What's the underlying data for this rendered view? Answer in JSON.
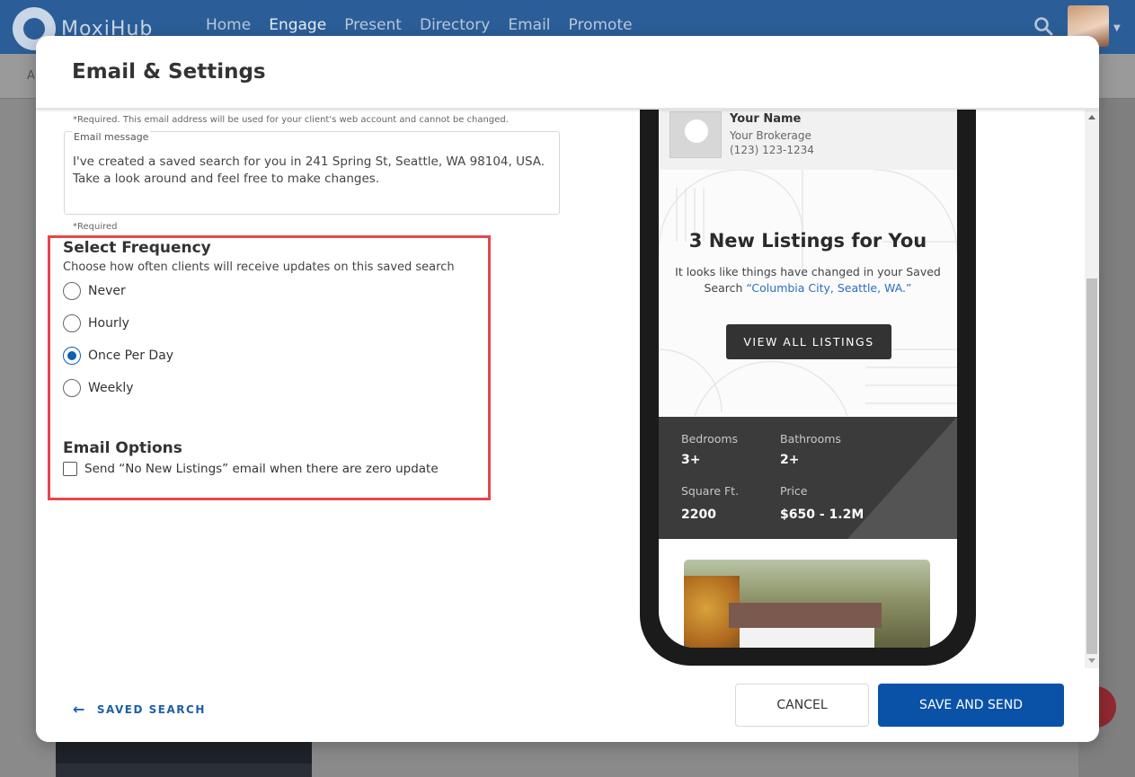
{
  "nav": {
    "logo": "MoxiHub",
    "links": [
      "Home",
      "Engage",
      "Present",
      "Directory",
      "Email",
      "Promote"
    ],
    "active": "Engage",
    "subbar_letter": "A"
  },
  "modal": {
    "title": "Email & Settings",
    "required_email_note": "*Required. This email address will be used for your client's web account and cannot be changed.",
    "email_message": {
      "label": "Email message",
      "value": "I've created a saved search for you in 241 Spring St, Seattle, WA 98104, USA. Take a look around and feel free to make changes."
    },
    "required_note": "*Required",
    "frequency": {
      "title": "Select Frequency",
      "subtitle": "Choose how often clients will receive updates on this saved search",
      "options": [
        {
          "label": "Never",
          "checked": false
        },
        {
          "label": "Hourly",
          "checked": false
        },
        {
          "label": "Once Per Day",
          "checked": true
        },
        {
          "label": "Weekly",
          "checked": false
        }
      ]
    },
    "email_options": {
      "title": "Email Options",
      "checkbox_label": "Send “No New Listings” email when there are zero update",
      "checked": false
    },
    "preview": {
      "agent_name": "Your Name",
      "brokerage": "Your Brokerage",
      "phone": "(123) 123-1234",
      "headline": "3 New Listings for You",
      "lead_text": "It looks like things have changed in your Saved Search ",
      "search_link": "“Columbia City, Seattle, WA.”",
      "button": "VIEW ALL LISTINGS",
      "stats": {
        "bedrooms_label": "Bedrooms",
        "bedrooms_value": "3+",
        "bathrooms_label": "Bathrooms",
        "bathrooms_value": "2+",
        "sqft_label": "Square Ft.",
        "sqft_value": "2200",
        "price_label": "Price",
        "price_value": "$650 - 1.2M"
      }
    },
    "footer": {
      "back_label": "SAVED SEARCH",
      "cancel_label": "CANCEL",
      "save_label": "SAVE AND SEND"
    }
  },
  "colors": {
    "primary": "#0a52a8",
    "nav_bg": "#2b5e98",
    "highlight": "#e4464a",
    "link": "#2a6fbf"
  }
}
